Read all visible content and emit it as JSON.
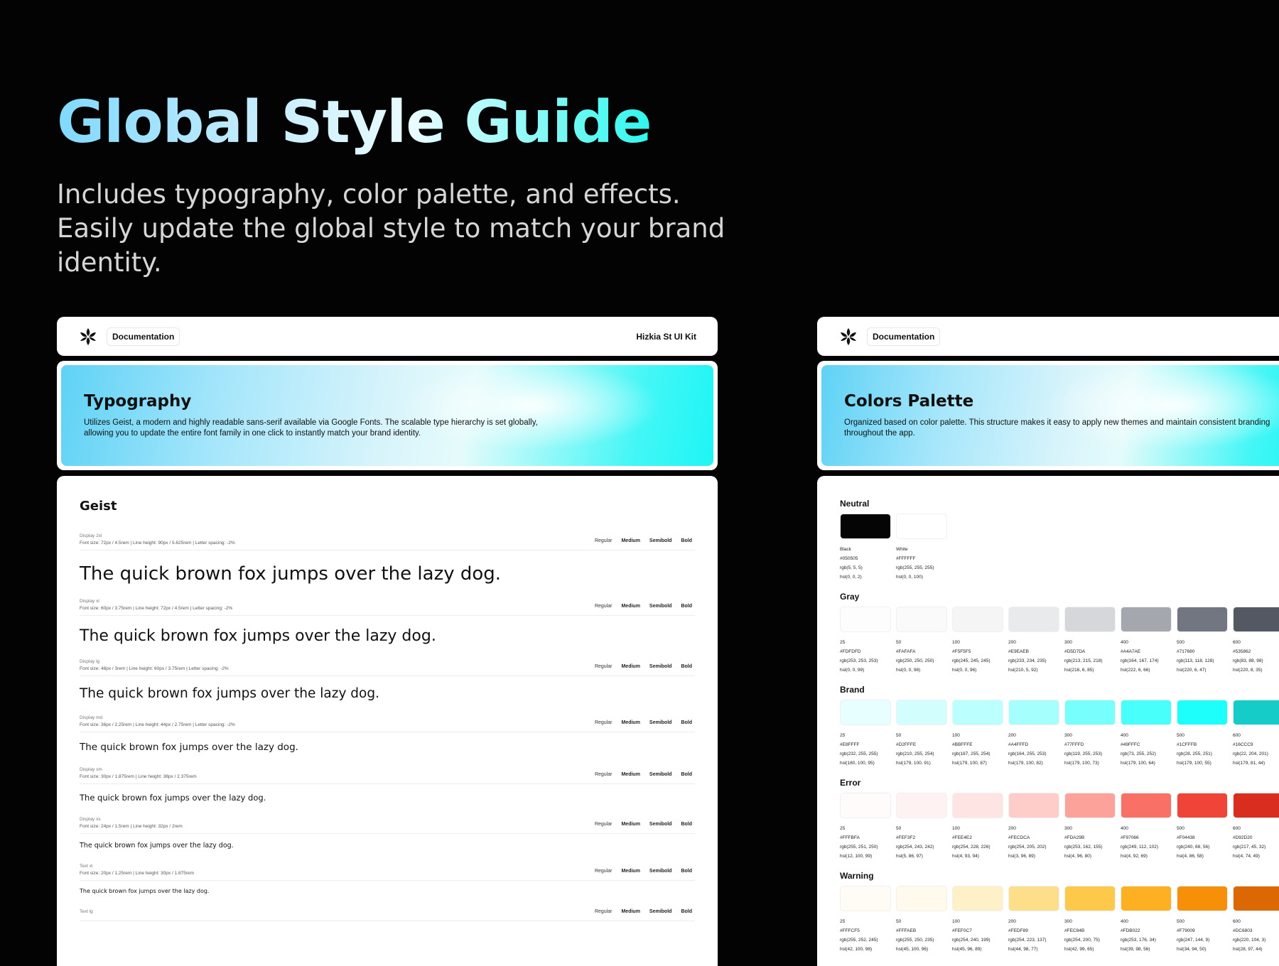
{
  "hero": {
    "title": "Global Style Guide",
    "subtitle": "Includes typography, color palette, and effects. Easily update the global style to match your brand identity."
  },
  "left_card": {
    "doc_label": "Documentation",
    "kit_name": "Hizkia St UI Kit",
    "banner_title": "Typography",
    "banner_desc": "Utilizes Geist, a modern and highly readable sans-serif available via Google Fonts. The scalable type hierarchy is set globally, allowing you to update the entire font family in one click to instantly match your brand identity.",
    "font_name": "Geist",
    "weights": [
      "Regular",
      "Medium",
      "Semibold",
      "Bold"
    ],
    "sample_text": "The quick brown fox jumps over the lazy dog.",
    "rows": [
      {
        "label": "Display 2xl",
        "spec": "Font size: 72px / 4.5rem | Line height: 90px / 5.625rem | Letter spacing: -2%"
      },
      {
        "label": "Display xl",
        "spec": "Font size: 60px / 3.75rem | Line height: 72px / 4.5rem | Letter spacing: -2%"
      },
      {
        "label": "Display lg",
        "spec": "Font size: 48px / 3rem | Line height: 60px / 3.75rem | Letter spacing: -2%"
      },
      {
        "label": "Display md",
        "spec": "Font size: 36px / 2.25rem | Line height: 44px / 2.75rem | Letter spacing: -2%"
      },
      {
        "label": "Display sm",
        "spec": "Font size: 30px / 1.875rem | Line height: 38px / 2.375rem"
      },
      {
        "label": "Display xs",
        "spec": "Font size: 24px / 1.5rem | Line height: 32px / 2rem"
      },
      {
        "label": "Text xl",
        "spec": "Font size: 20px / 1.25rem | Line height: 30px / 1.875rem"
      },
      {
        "label": "Text lg",
        "spec": ""
      }
    ]
  },
  "right_card": {
    "doc_label": "Documentation",
    "banner_title": "Colors Palette",
    "banner_desc": "Organized based on color palette. This structure makes it easy to apply new themes and maintain consistent branding throughout the app.",
    "neutral": {
      "title": "Neutral",
      "swatches": [
        {
          "name": "Black",
          "hex": "#050505",
          "rgb": "rgb(5, 5, 5)",
          "hsl": "hsl(0, 0, 2)",
          "color": "#050505"
        },
        {
          "name": "White",
          "hex": "#FFFFFF",
          "rgb": "rgb(255, 255, 255)",
          "hsl": "hsl(0, 0, 100)",
          "color": "#FFFFFF"
        }
      ]
    },
    "groups": [
      {
        "title": "Gray",
        "swatches": [
          {
            "step": "25",
            "hex": "#FDFDFD",
            "rgb": "rgb(253, 253, 253)",
            "hsl": "hsl(0, 0, 99)",
            "color": "#FDFDFD"
          },
          {
            "step": "50",
            "hex": "#FAFAFA",
            "rgb": "rgb(250, 250, 250)",
            "hsl": "hsl(0, 0, 98)",
            "color": "#FAFAFA"
          },
          {
            "step": "100",
            "hex": "#F5F5F5",
            "rgb": "rgb(245, 245, 245)",
            "hsl": "hsl(0, 0, 96)",
            "color": "#F5F5F5"
          },
          {
            "step": "200",
            "hex": "#E9EAEB",
            "rgb": "rgb(233, 234, 235)",
            "hsl": "hsl(210, 5, 92)",
            "color": "#E9EAEB"
          },
          {
            "step": "300",
            "hex": "#D5D7DA",
            "rgb": "rgb(213, 215, 218)",
            "hsl": "hsl(216, 6, 85)",
            "color": "#D5D7DA"
          },
          {
            "step": "400",
            "hex": "#A4A7AE",
            "rgb": "rgb(164, 167, 174)",
            "hsl": "hsl(222, 6, 66)",
            "color": "#A4A7AE"
          },
          {
            "step": "500",
            "hex": "#717680",
            "rgb": "rgb(113, 118, 128)",
            "hsl": "hsl(220, 6, 47)",
            "color": "#717680"
          },
          {
            "step": "600",
            "hex": "#535862",
            "rgb": "rgb(83, 88, 98)",
            "hsl": "hsl(220, 8, 35)",
            "color": "#535862"
          }
        ]
      },
      {
        "title": "Brand",
        "swatches": [
          {
            "step": "25",
            "hex": "#E8FFFF",
            "rgb": "rgb(232, 255, 255)",
            "hsl": "hsl(180, 100, 95)",
            "color": "#E8FFFF"
          },
          {
            "step": "50",
            "hex": "#D2FFFE",
            "rgb": "rgb(210, 255, 254)",
            "hsl": "hsl(179, 100, 91)",
            "color": "#D2FFFE"
          },
          {
            "step": "100",
            "hex": "#BBFFFE",
            "rgb": "rgb(187, 255, 254)",
            "hsl": "hsl(179, 100, 87)",
            "color": "#BBFFFE"
          },
          {
            "step": "200",
            "hex": "#A4FFFD",
            "rgb": "rgb(164, 255, 253)",
            "hsl": "hsl(179, 100, 82)",
            "color": "#A4FFFD"
          },
          {
            "step": "300",
            "hex": "#77FFFD",
            "rgb": "rgb(119, 255, 253)",
            "hsl": "hsl(179, 100, 73)",
            "color": "#77FFFD"
          },
          {
            "step": "400",
            "hex": "#49FFFC",
            "rgb": "rgb(73, 255, 252)",
            "hsl": "hsl(179, 100, 64)",
            "color": "#49FFFC"
          },
          {
            "step": "500",
            "hex": "#1CFFFB",
            "rgb": "rgb(28, 255, 251)",
            "hsl": "hsl(179, 100, 55)",
            "color": "#1CFFFB"
          },
          {
            "step": "600",
            "hex": "#16CCC9",
            "rgb": "rgb(22, 204, 201)",
            "hsl": "hsl(179, 81, 44)",
            "color": "#16CCC9"
          }
        ]
      },
      {
        "title": "Error",
        "swatches": [
          {
            "step": "25",
            "hex": "#FFFBFA",
            "rgb": "rgb(255, 251, 250)",
            "hsl": "hsl(12, 100, 99)",
            "color": "#FFFBFA"
          },
          {
            "step": "50",
            "hex": "#FEF3F2",
            "rgb": "rgb(254, 243, 242)",
            "hsl": "hsl(5, 86, 97)",
            "color": "#FEF3F2"
          },
          {
            "step": "100",
            "hex": "#FEE4E2",
            "rgb": "rgb(254, 228, 226)",
            "hsl": "hsl(4, 93, 94)",
            "color": "#FEE4E2"
          },
          {
            "step": "200",
            "hex": "#FECDCA",
            "rgb": "rgb(254, 205, 202)",
            "hsl": "hsl(3, 96, 89)",
            "color": "#FECDCA"
          },
          {
            "step": "300",
            "hex": "#FDA29B",
            "rgb": "rgb(253, 162, 155)",
            "hsl": "hsl(4, 96, 80)",
            "color": "#FDA29B"
          },
          {
            "step": "400",
            "hex": "#F97066",
            "rgb": "rgb(249, 112, 102)",
            "hsl": "hsl(4, 92, 69)",
            "color": "#F97066"
          },
          {
            "step": "500",
            "hex": "#F04438",
            "rgb": "rgb(240, 68, 56)",
            "hsl": "hsl(4, 86, 58)",
            "color": "#F04438"
          },
          {
            "step": "600",
            "hex": "#D92D20",
            "rgb": "rgb(217, 45, 32)",
            "hsl": "hsl(4, 74, 49)",
            "color": "#D92D20"
          }
        ]
      },
      {
        "title": "Warning",
        "swatches": [
          {
            "step": "25",
            "hex": "#FFFCF5",
            "rgb": "rgb(255, 252, 245)",
            "hsl": "hsl(42, 100, 98)",
            "color": "#FFFCF5"
          },
          {
            "step": "50",
            "hex": "#FFFAEB",
            "rgb": "rgb(255, 250, 235)",
            "hsl": "hsl(45, 100, 96)",
            "color": "#FFFAEB"
          },
          {
            "step": "100",
            "hex": "#FEF0C7",
            "rgb": "rgb(254, 240, 199)",
            "hsl": "hsl(45, 96, 89)",
            "color": "#FEF0C7"
          },
          {
            "step": "200",
            "hex": "#FEDF89",
            "rgb": "rgb(254, 223, 137)",
            "hsl": "hsl(44, 98, 77)",
            "color": "#FEDF89"
          },
          {
            "step": "300",
            "hex": "#FEC84B",
            "rgb": "rgb(254, 200, 75)",
            "hsl": "hsl(42, 99, 65)",
            "color": "#FEC84B"
          },
          {
            "step": "400",
            "hex": "#FDB022",
            "rgb": "rgb(253, 176, 34)",
            "hsl": "hsl(39, 98, 56)",
            "color": "#FDB022"
          },
          {
            "step": "500",
            "hex": "#F79009",
            "rgb": "rgb(247, 144, 9)",
            "hsl": "hsl(34, 94, 50)",
            "color": "#F79009"
          },
          {
            "step": "600",
            "hex": "#DC6803",
            "rgb": "rgb(220, 104, 3)",
            "hsl": "hsl(28, 97, 44)",
            "color": "#DC6803"
          }
        ]
      }
    ]
  }
}
